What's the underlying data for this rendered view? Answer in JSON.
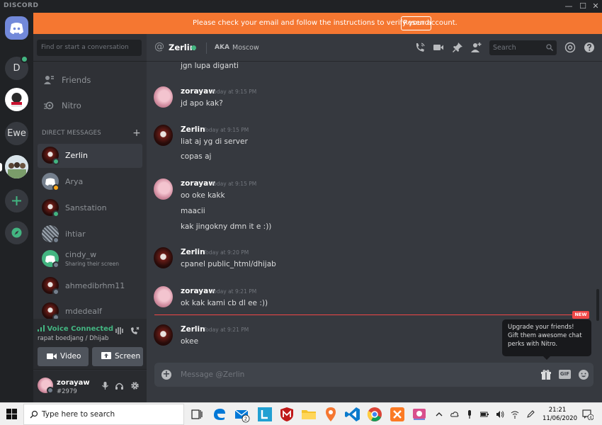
{
  "app": {
    "title": "DISCORD"
  },
  "window_controls": {
    "minimize": "—",
    "maximize": "☐",
    "close": "✕"
  },
  "servers": [
    {
      "label": "D"
    },
    {
      "label": "Ewe"
    }
  ],
  "banner": {
    "message": "Please check your email and follow the instructions to verify your account.",
    "button": "Resend"
  },
  "dm_search": {
    "placeholder": "Find or start a conversation"
  },
  "nav": {
    "friends": "Friends",
    "nitro": "Nitro"
  },
  "dm_header": {
    "label": "DIRECT MESSAGES",
    "add": "+"
  },
  "dms": [
    {
      "name": "Zerlin",
      "status_color": "#43b581"
    },
    {
      "name": "Arya",
      "status_color": "#faa61a"
    },
    {
      "name": "Sanstation",
      "status_color": "#43b581"
    },
    {
      "name": "ihtiar",
      "status_color": "#747f8d"
    },
    {
      "name": "cindy_w",
      "sub": "Sharing their screen",
      "status_color": "#747f8d"
    },
    {
      "name": "ahmedibrhm11",
      "status_color": "#747f8d"
    },
    {
      "name": "mdedealf",
      "status_color": "#747f8d"
    }
  ],
  "voice": {
    "status": "Voice Connected",
    "channel": "rapat boedjang / Dhijab",
    "video": "Video",
    "screen": "Screen"
  },
  "user": {
    "name": "zorayaw",
    "tag": "#2979"
  },
  "chat_header": {
    "at": "@",
    "name": "Zerlin",
    "aka_label": "AKA",
    "aka_value": "Moscow",
    "search_placeholder": "Search"
  },
  "messages": {
    "top_line": "jgn lupa diganti",
    "groups": [
      {
        "author": "zorayaw",
        "time": "Today at 9:15 PM",
        "lines": [
          "jd apo kak?"
        ]
      },
      {
        "author": "Zerlin",
        "time": "Today at 9:15 PM",
        "lines": [
          "liat aj yg di server",
          "copas aj"
        ]
      },
      {
        "author": "zorayaw",
        "time": "Today at 9:15 PM",
        "lines": [
          "oo oke kakk",
          "maacii",
          "kak jingokny dmn it e :))"
        ]
      },
      {
        "author": "Zerlin",
        "time": "Today at 9:20 PM",
        "lines": [
          "cpanel public_html/dhijab"
        ]
      },
      {
        "author": "zorayaw",
        "time": "Today at 9:21 PM",
        "lines": [
          "ok kak kami cb dl ee :))"
        ]
      },
      {
        "author": "Zerlin",
        "time": "Today at 9:21 PM",
        "lines": [
          "okee"
        ]
      }
    ]
  },
  "new_tag": "NEW",
  "tooltip": {
    "text": "Upgrade your friends! Gift them awesome chat perks with Nitro."
  },
  "composer": {
    "placeholder": "Message @Zerlin",
    "gif": "GIF"
  },
  "taskbar": {
    "search_placeholder": "Type here to search",
    "time": "21:21",
    "date": "11/06/2020",
    "mail_badge": "2",
    "notif_count": "4"
  }
}
